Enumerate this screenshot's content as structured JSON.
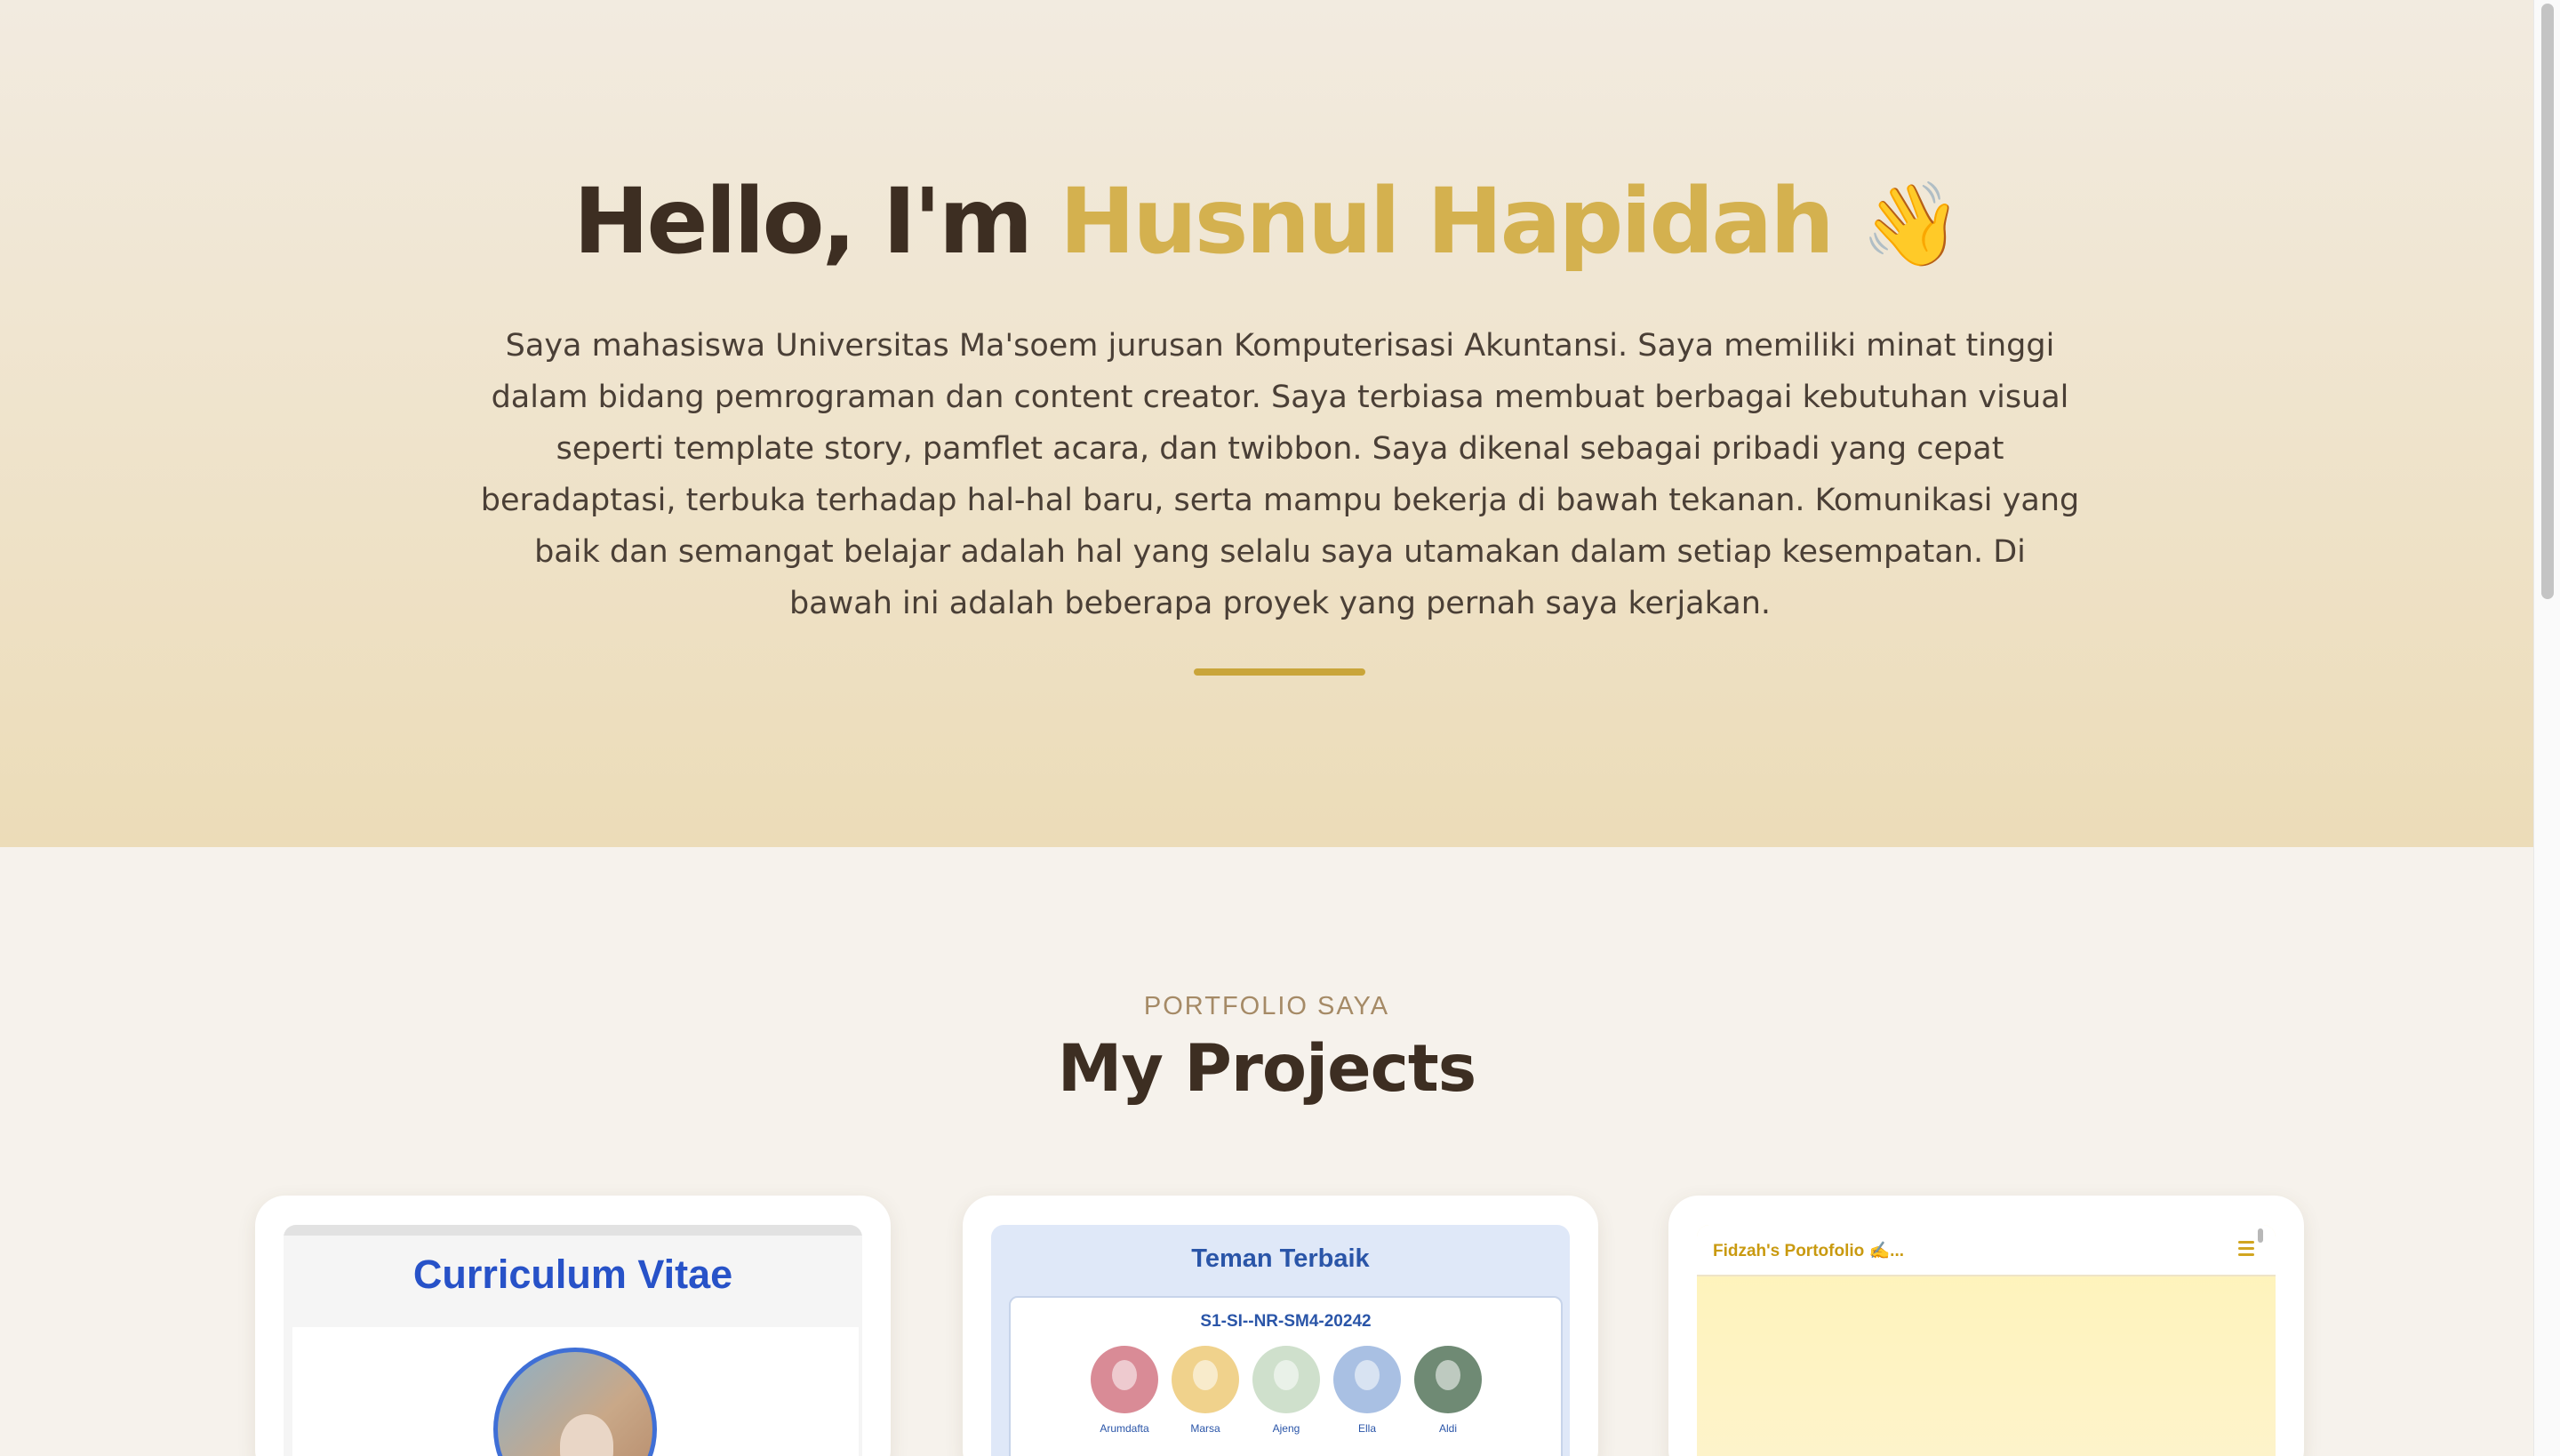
{
  "hero": {
    "greeting": "Hello, I'm",
    "name": "Husnul Hapidah",
    "wave_emoji": "👋",
    "bio": "Saya mahasiswa Universitas Ma'soem jurusan Komputerisasi Akuntansi. Saya memiliki minat tinggi dalam bidang pemrograman dan content creator. Saya terbiasa membuat berbagai kebutuhan visual seperti template story, pamflet acara, dan twibbon. Saya dikenal sebagai pribadi yang cepat beradaptasi, terbuka terhadap hal-hal baru, serta mampu bekerja di bawah tekanan. Komunikasi yang baik dan semangat belajar adalah hal yang selalu saya utamakan dalam setiap kesempatan. Di bawah ini adalah beberapa proyek yang pernah saya kerjakan."
  },
  "projects": {
    "kicker": "PORTFOLIO SAYA",
    "title": "My Projects",
    "cards": [
      {
        "preview_title": "Curriculum Vitae"
      },
      {
        "preview_title": "Teman Terbaik",
        "class_label": "S1-SI--NR-SM4-20242",
        "friends": [
          {
            "name": "Arumdafta",
            "color": "#d98b96"
          },
          {
            "name": "Marsa",
            "color": "#f0d28c"
          },
          {
            "name": "Ajeng",
            "color": "#cfe0cc"
          },
          {
            "name": "Ella",
            "color": "#a9c0e3"
          },
          {
            "name": "Aldi",
            "color": "#6f8a74"
          }
        ]
      },
      {
        "preview_title": "Fidzah's Portofolio ✍️..."
      }
    ]
  },
  "colors": {
    "accent_gold": "#d4b14f",
    "heading_brown": "#3d2e22",
    "cv_blue": "#2752c8"
  }
}
